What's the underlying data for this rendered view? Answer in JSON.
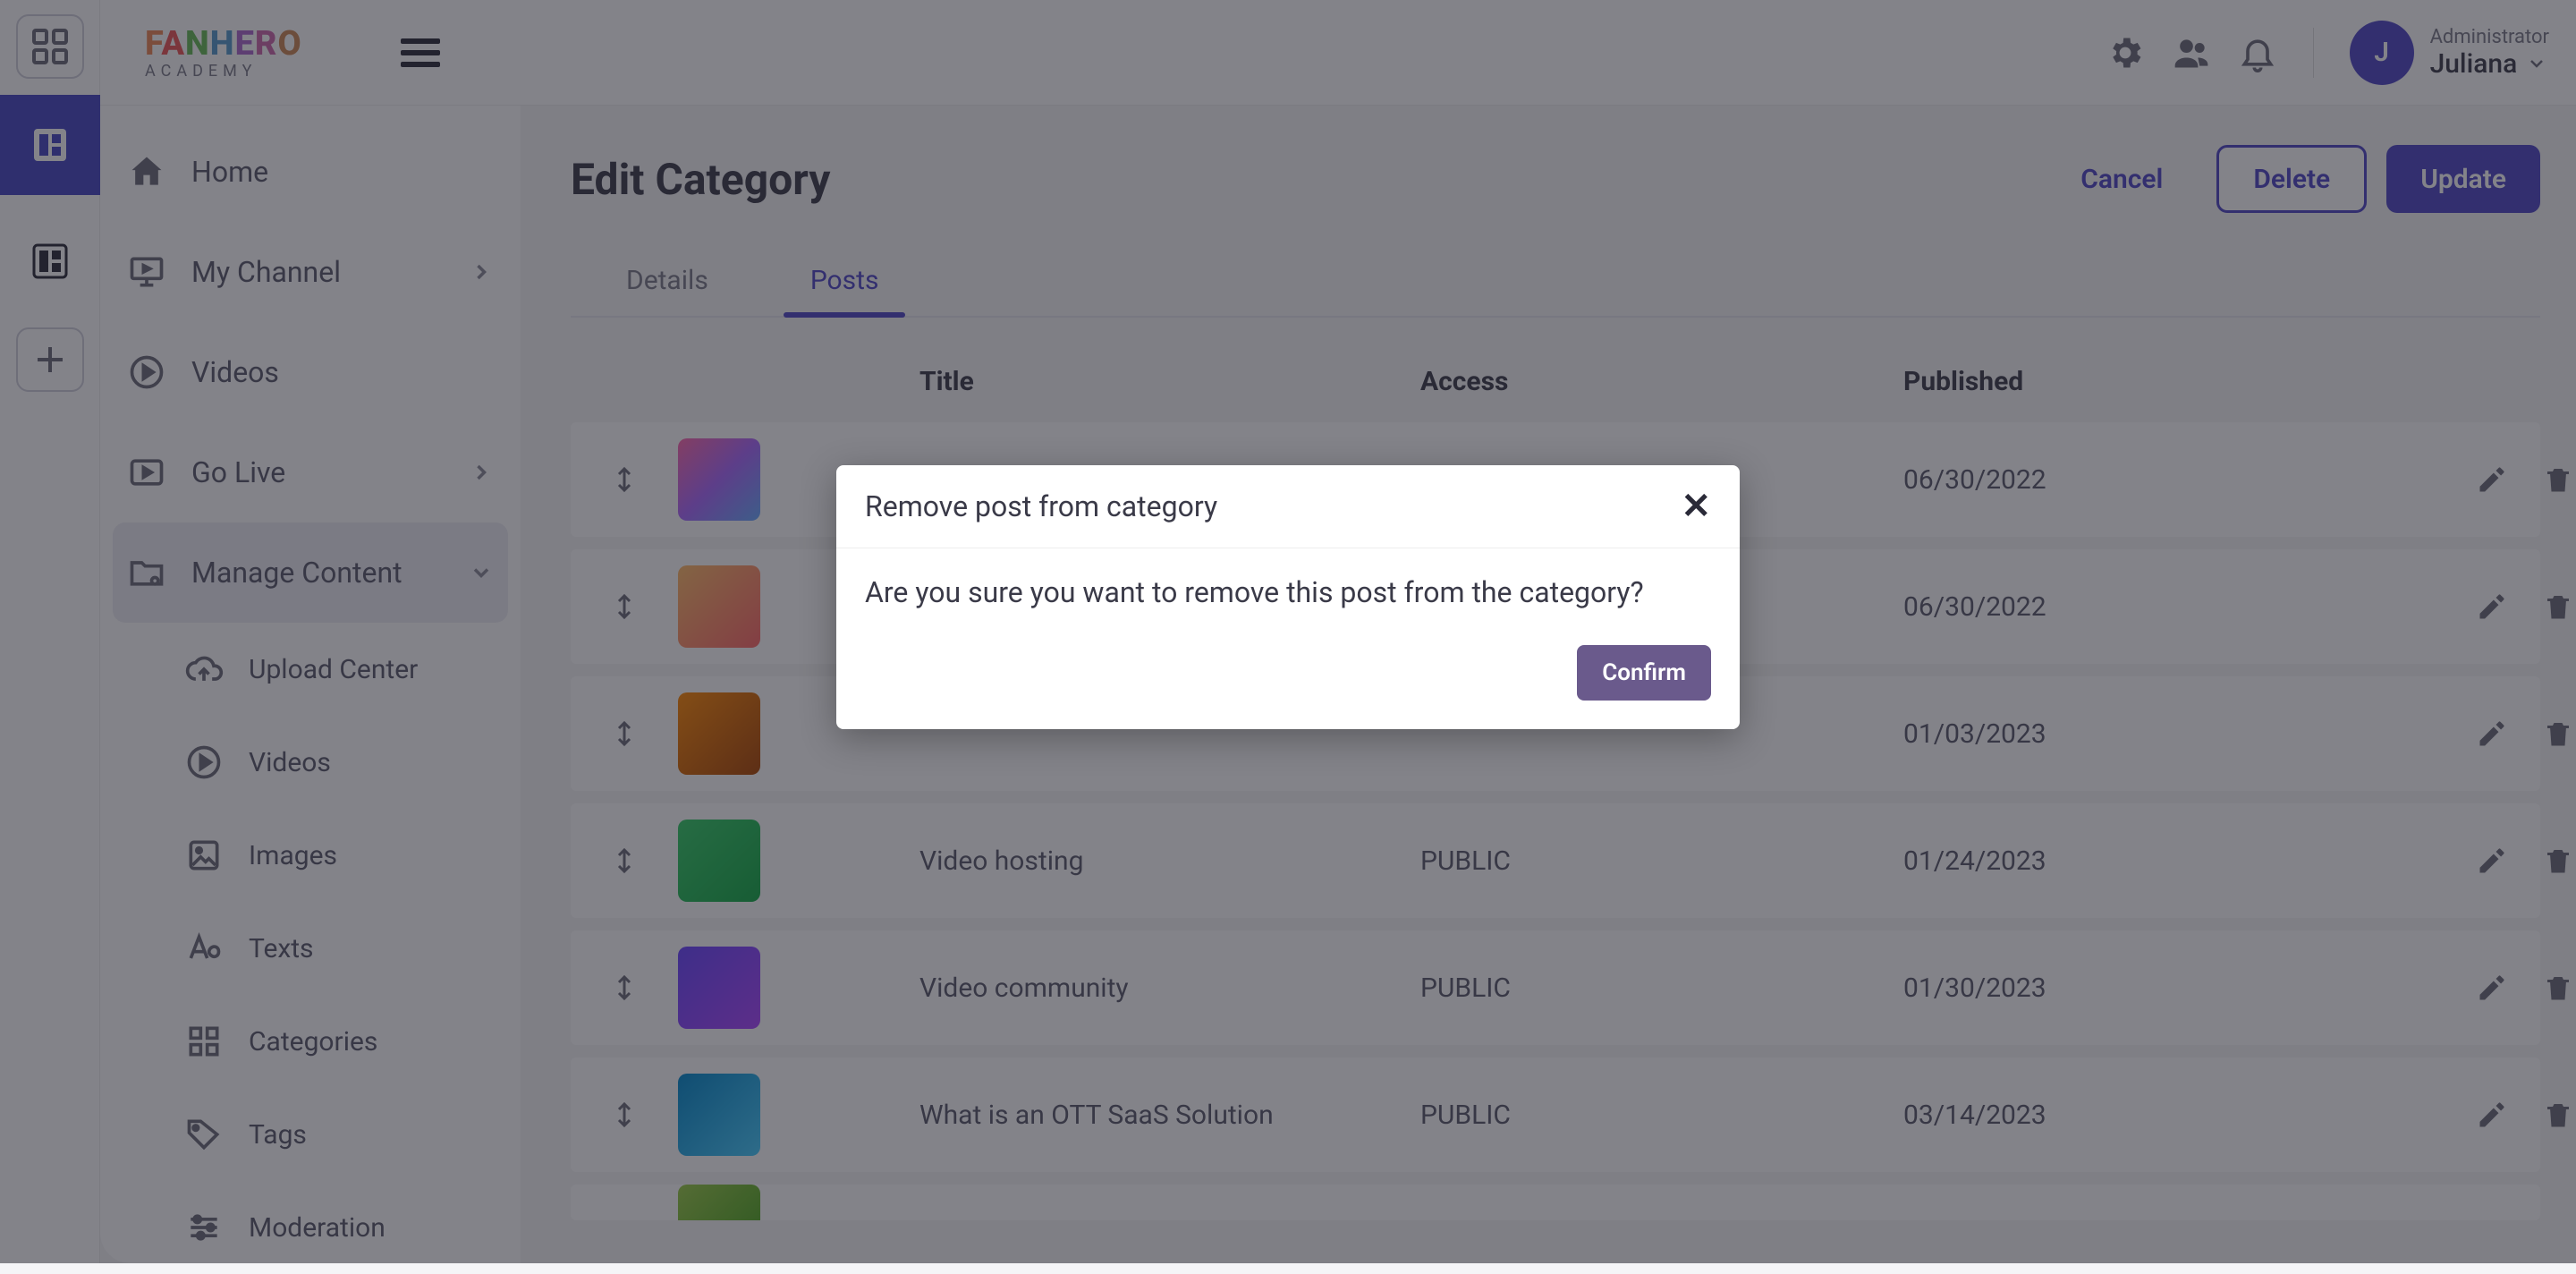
{
  "brand": {
    "name": "FANHERO",
    "sub": "ACADEMY"
  },
  "user": {
    "role": "Administrator",
    "name": "Juliana",
    "initial": "J"
  },
  "nav": {
    "home": "Home",
    "my_channel": "My Channel",
    "videos": "Videos",
    "go_live": "Go Live",
    "manage_content": "Manage Content",
    "upload_center": "Upload Center",
    "videos_sub": "Videos",
    "images": "Images",
    "texts": "Texts",
    "categories": "Categories",
    "tags": "Tags",
    "moderation": "Moderation"
  },
  "page": {
    "title": "Edit Category",
    "cancel": "Cancel",
    "delete": "Delete",
    "update": "Update"
  },
  "tabs": {
    "details": "Details",
    "posts": "Posts"
  },
  "table": {
    "headers": {
      "title": "Title",
      "access": "Access",
      "published": "Published"
    },
    "rows": [
      {
        "title": "",
        "access": "",
        "published": "06/30/2022"
      },
      {
        "title": "",
        "access": "",
        "published": "06/30/2022"
      },
      {
        "title": "",
        "access": "",
        "published": "01/03/2023"
      },
      {
        "title": "Video hosting",
        "access": "PUBLIC",
        "published": "01/24/2023"
      },
      {
        "title": "Video community",
        "access": "PUBLIC",
        "published": "01/30/2023"
      },
      {
        "title": "What is an OTT SaaS Solution",
        "access": "PUBLIC",
        "published": "03/14/2023"
      }
    ]
  },
  "modal": {
    "title": "Remove post from category",
    "body": "Are you sure you want to remove this post from the category?",
    "confirm": "Confirm"
  }
}
